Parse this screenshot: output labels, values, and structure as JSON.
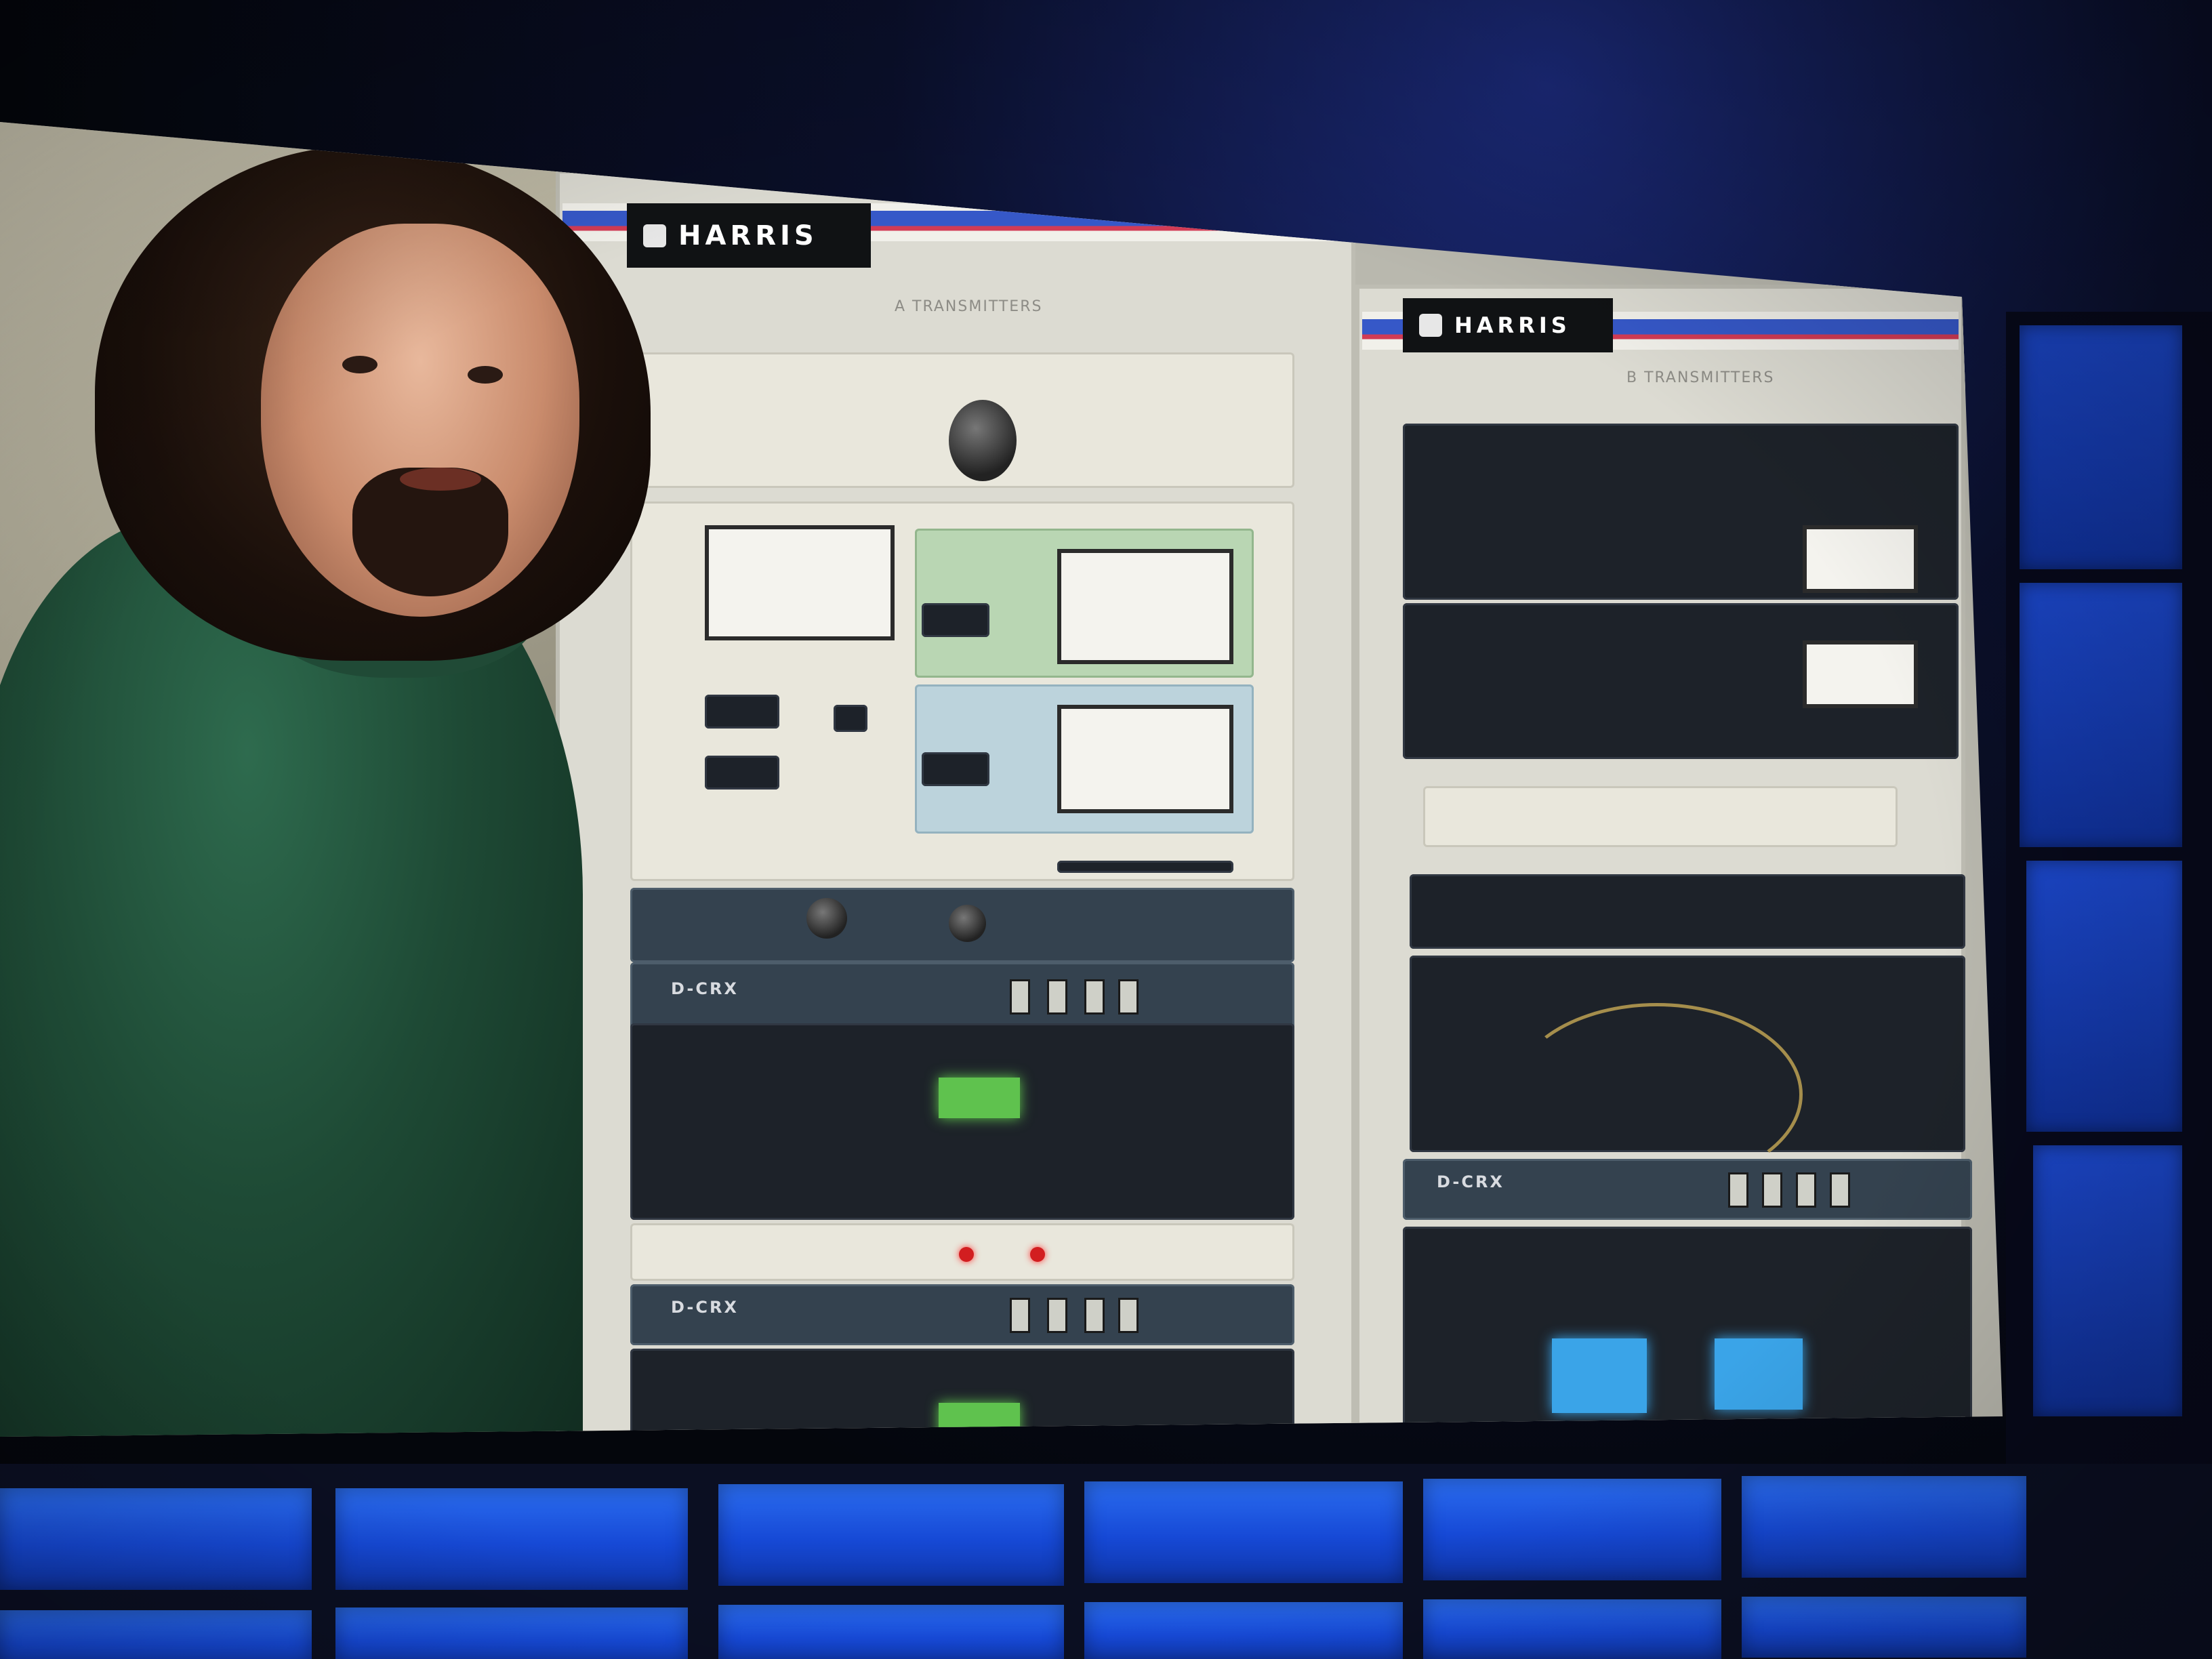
{
  "scene": {
    "description_text": "",
    "rack_left": {
      "brand": "HARRIS",
      "label": "A TRANSMITTERS"
    },
    "rack_right": {
      "brand": "HARRIS",
      "label": "B TRANSMITTERS"
    },
    "equipment_badges": [
      "D-CRX",
      "D-CRX",
      "D-CRX"
    ],
    "colors": {
      "stage_blue": "#1649d6",
      "sweater_green": "#1e4a35",
      "harris_stripe_blue": "#3658c8",
      "harris_stripe_red": "#d23b55"
    }
  }
}
